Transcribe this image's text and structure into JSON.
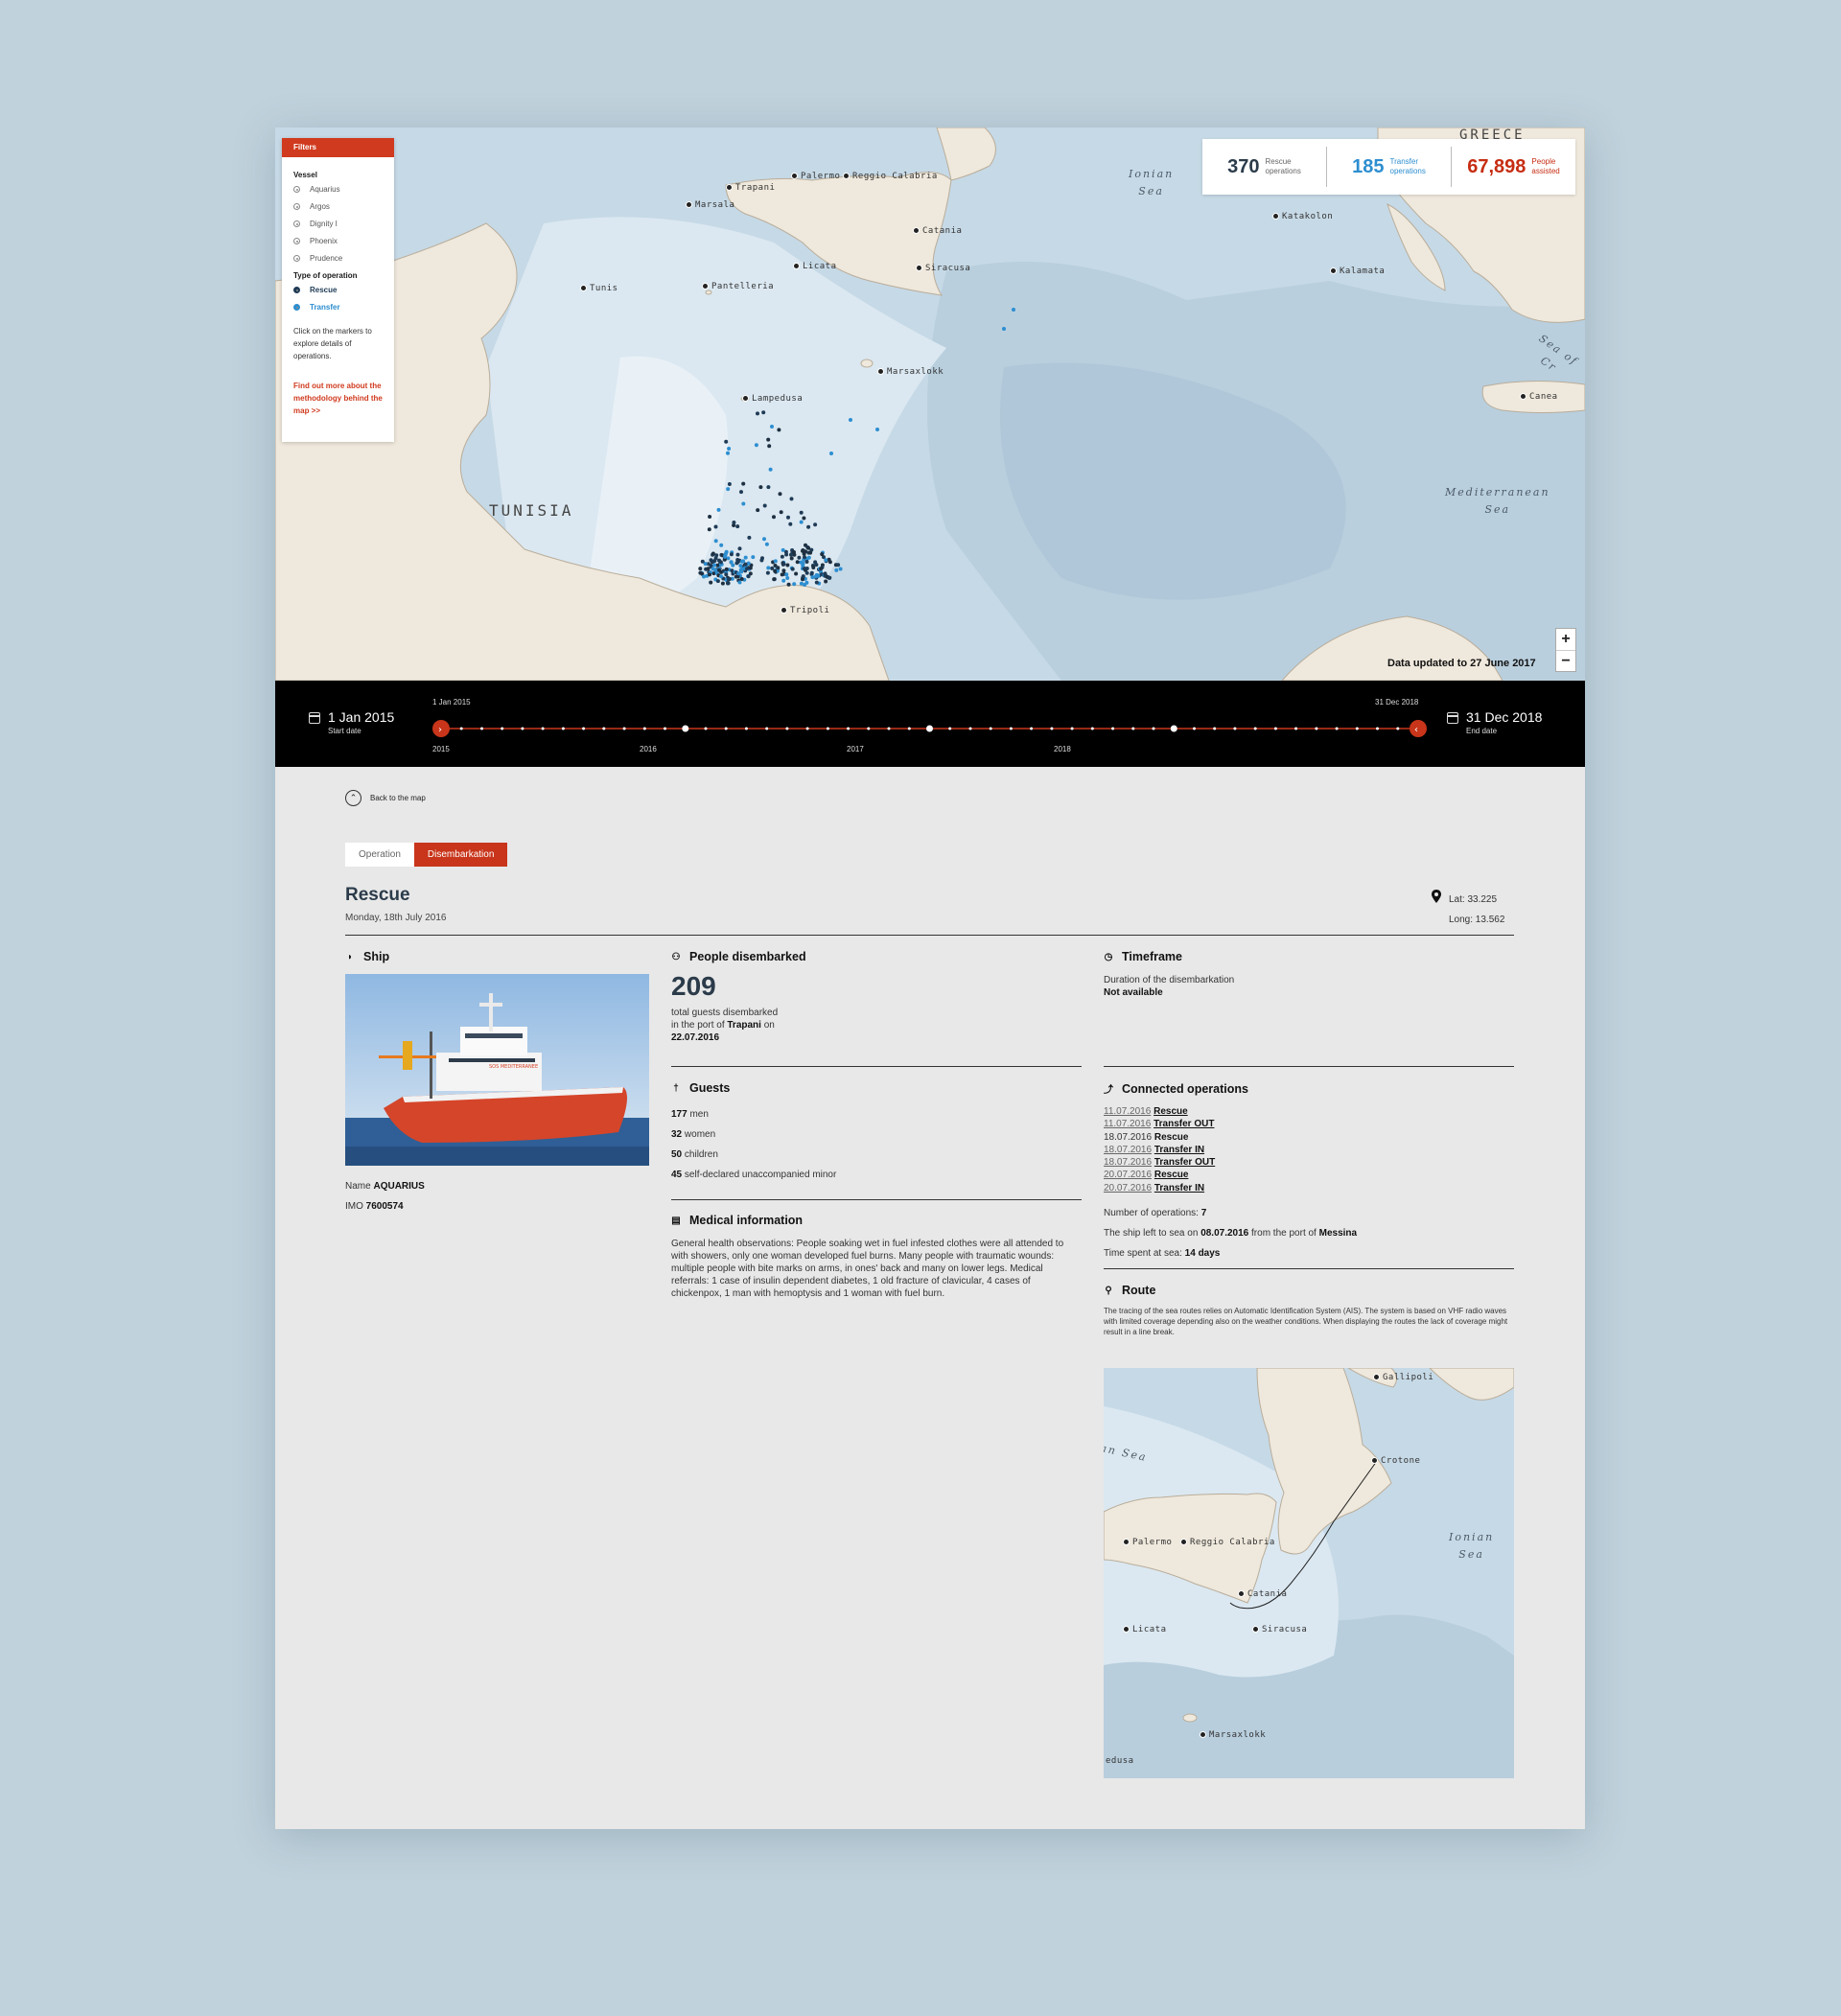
{
  "map": {
    "places": {
      "trapani": "Trapani",
      "palermo": "Palermo",
      "reggio": "Reggio Calabria",
      "marsala": "Marsala",
      "catania": "Catania",
      "licata": "Licata",
      "siracusa": "Siracusa",
      "pantelleria": "Pantelleria",
      "marsaxlokk": "Marsaxlokk",
      "lampedusa": "Lampedusa",
      "tunis": "Tunis",
      "tripoli": "Tripoli",
      "katakolon": "Katakolon",
      "kalamata": "Kalamata",
      "canea": "Canea"
    },
    "regions": {
      "tunisia": "TUNISIA",
      "greece": "GREECE"
    },
    "seas": {
      "ionian": [
        "Ionian",
        "Sea"
      ],
      "mediterranean": [
        "Mediterranean",
        "Sea"
      ],
      "crete": "Sea of Cr"
    },
    "updated": "Data updated to 27 June 2017",
    "zoom_in": "+",
    "zoom_out": "−"
  },
  "filters": {
    "header": "Filters",
    "vessel_title": "Vessel",
    "vessels": [
      "Aquarius",
      "Argos",
      "Dignity I",
      "Phoenix",
      "Prudence"
    ],
    "type_title": "Type of operation",
    "types": {
      "rescue": "Rescue",
      "transfer": "Transfer"
    },
    "note": "Click on the markers to explore details of operations.",
    "link": "Find out more about the methodology behind the map >>"
  },
  "stats": {
    "rescue": {
      "value": "370",
      "label_1": "Rescue",
      "label_2": "operations"
    },
    "transfer": {
      "value": "185",
      "label_1": "Transfer",
      "label_2": "operations"
    },
    "people": {
      "value": "67,898",
      "label_1": "People",
      "label_2": "assisted"
    }
  },
  "timeline": {
    "start_date": "1 Jan 2015",
    "start_label": "Start date",
    "end_date": "31 Dec 2018",
    "end_label": "End date",
    "range_start": "1 Jan 2015",
    "range_end": "31 Dec 2018",
    "years": [
      "2015",
      "2016",
      "2017",
      "2018"
    ]
  },
  "detail": {
    "back": "Back to the map",
    "tabs": {
      "operation": "Operation",
      "disembarkation": "Disembarkation"
    },
    "title": "Rescue",
    "date": "Monday, 18th July 2016",
    "lat": "Lat: 33.225",
    "long": "Long: 13.562",
    "ship": {
      "heading": "Ship",
      "name_label": "Name",
      "name": "AQUARIUS",
      "imo_label": "IMO",
      "imo": "7600574",
      "hull_text": "SOS MEDITERRANEE"
    },
    "people": {
      "heading": "People disembarked",
      "count": "209",
      "line1": "total guests disembarked",
      "line2_pre": "in the port of",
      "port": "Trapani",
      "line2_post": "on",
      "date": "22.07.2016"
    },
    "guests": {
      "heading": "Guests",
      "rows": [
        {
          "n": "177",
          "t": "men"
        },
        {
          "n": "32",
          "t": "women"
        },
        {
          "n": "50",
          "t": "children"
        },
        {
          "n": "45",
          "t": "self-declared unaccompanied minor"
        }
      ]
    },
    "medical": {
      "heading": "Medical information",
      "text": "General health observations: People soaking wet in fuel infested clothes were all attended to with showers, only one woman developed fuel burns. Many people with traumatic wounds: multiple people with bite marks on arms, in ones' back and many on lower legs. Medical referrals: 1 case of insulin dependent diabetes, 1 old fracture of clavicular, 4 cases of chickenpox, 1 man with hemoptysis and 1 woman with fuel burn."
    },
    "timeframe": {
      "heading": "Timeframe",
      "label": "Duration of the disembarkation",
      "value": "Not available"
    },
    "connected": {
      "heading": "Connected operations",
      "items": [
        {
          "date": "11.07.2016",
          "type": "Rescue",
          "link": true
        },
        {
          "date": "11.07.2016",
          "type": "Transfer OUT",
          "link": true
        },
        {
          "date": "18.07.2016",
          "type": "Rescue",
          "link": false
        },
        {
          "date": "18.07.2016",
          "type": "Transfer IN",
          "link": true
        },
        {
          "date": "18.07.2016",
          "type": "Transfer OUT",
          "link": true
        },
        {
          "date": "20.07.2016",
          "type": "Rescue",
          "link": true
        },
        {
          "date": "20.07.2016",
          "type": "Transfer IN",
          "link": true
        }
      ],
      "count_label": "Number of operations:",
      "count": "7",
      "left_pre": "The ship left to sea on",
      "left_date": "08.07.2016",
      "left_mid": "from the port of",
      "left_port": "Messina",
      "time_label": "Time spent at sea:",
      "time_value": "14 days"
    },
    "route": {
      "heading": "Route",
      "text": "The tracing of the sea routes relies on Automatic Identification System (AIS). The system is based on VHF radio waves with limited coverage depending also on the weather conditions. When displaying the routes the lack of coverage might result in a line break.",
      "places": {
        "gallipoli": "Gallipoli",
        "crotone": "Crotone",
        "palermo": "Palermo",
        "reggio": "Reggio Calabria",
        "catania": "Catania",
        "licata": "Licata",
        "siracusa": "Siracusa",
        "marsaxlokk": "Marsaxlokk",
        "edusa": "edusa"
      },
      "seas": {
        "ionian": [
          "Ionian",
          "Sea"
        ],
        "left": "an Sea"
      }
    }
  },
  "colors": {
    "accent": "#c8351a",
    "rescue": "#1f3b56",
    "transfer": "#2d8ed0",
    "land": "#efe8dc",
    "water": "#c9dce8"
  }
}
